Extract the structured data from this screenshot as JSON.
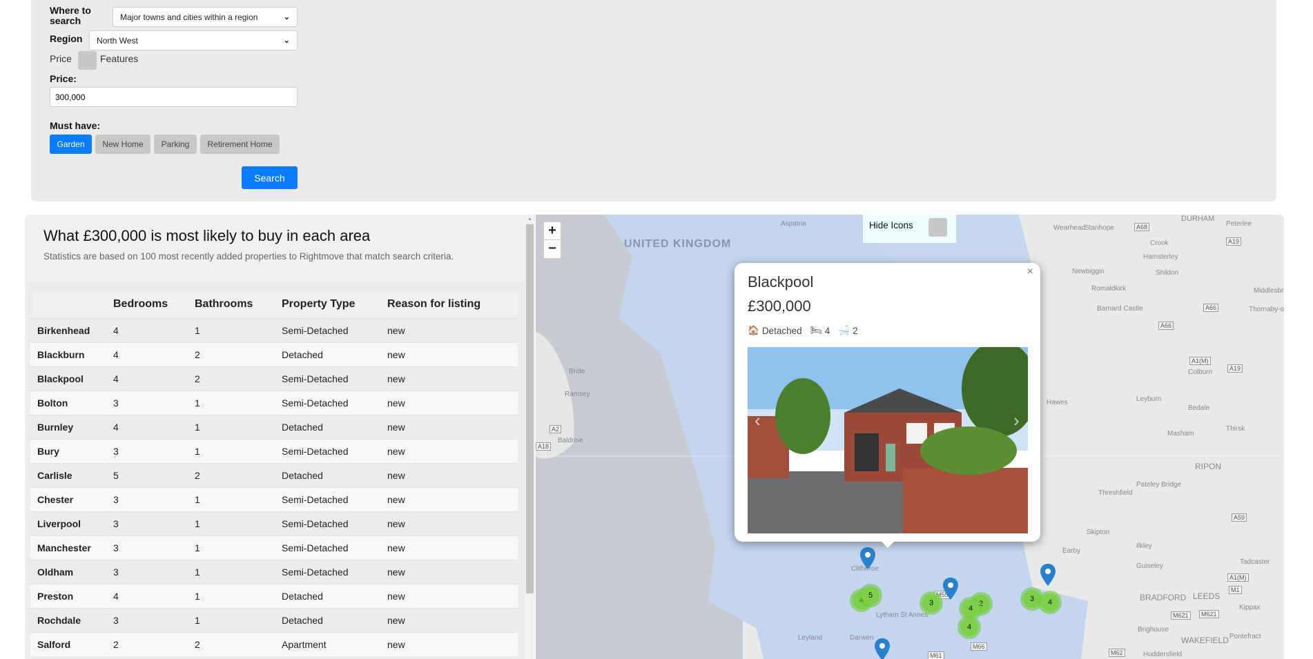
{
  "search": {
    "where_label": "Where to search",
    "where_value": "Major towns and cities within a region",
    "region_label": "Region",
    "region_value": "North West",
    "toggle_left": "Price",
    "toggle_right": "Features",
    "price_label": "Price:",
    "price_value": "300,000",
    "must_have_label": "Must have:",
    "features": [
      {
        "label": "Garden",
        "active": true
      },
      {
        "label": "New Home",
        "active": false
      },
      {
        "label": "Parking",
        "active": false
      },
      {
        "label": "Retirement Home",
        "active": false
      }
    ],
    "search_button": "Search"
  },
  "results": {
    "title": "What £300,000 is most likely to buy in each area",
    "subtitle": "Statistics are based on 100 most recently added properties to Rightmove that match search criteria.",
    "columns": [
      "",
      "Bedrooms",
      "Bathrooms",
      "Property Type",
      "Reason for listing"
    ],
    "rows": [
      [
        "Birkenhead",
        "4",
        "1",
        "Semi-Detached",
        "new"
      ],
      [
        "Blackburn",
        "4",
        "2",
        "Detached",
        "new"
      ],
      [
        "Blackpool",
        "4",
        "2",
        "Semi-Detached",
        "new"
      ],
      [
        "Bolton",
        "3",
        "1",
        "Semi-Detached",
        "new"
      ],
      [
        "Burnley",
        "4",
        "1",
        "Detached",
        "new"
      ],
      [
        "Bury",
        "3",
        "1",
        "Semi-Detached",
        "new"
      ],
      [
        "Carlisle",
        "5",
        "2",
        "Detached",
        "new"
      ],
      [
        "Chester",
        "3",
        "1",
        "Semi-Detached",
        "new"
      ],
      [
        "Liverpool",
        "3",
        "1",
        "Semi-Detached",
        "new"
      ],
      [
        "Manchester",
        "3",
        "1",
        "Semi-Detached",
        "new"
      ],
      [
        "Oldham",
        "3",
        "1",
        "Semi-Detached",
        "new"
      ],
      [
        "Preston",
        "4",
        "1",
        "Detached",
        "new"
      ],
      [
        "Rochdale",
        "3",
        "1",
        "Detached",
        "new"
      ],
      [
        "Salford",
        "2",
        "2",
        "Apartment",
        "new"
      ]
    ]
  },
  "map": {
    "zoom_in": "+",
    "zoom_out": "−",
    "hide_icons_label": "Hide Icons",
    "popup": {
      "title": "Blackpool",
      "price": "£300,000",
      "type": "Detached",
      "beds": "4",
      "baths": "2",
      "close": "×"
    },
    "labels": [
      "Aspatria",
      "UNITED KINGDOM",
      "DURHAM",
      "Wearhead",
      "Stanhope",
      "Peterlee",
      "Crook",
      "Hamsterley",
      "Shildon",
      "Newbiggin",
      "Romaldkirk",
      "Barnard Castle",
      "Hawes",
      "Leyburn",
      "Bedale",
      "Masham",
      "Thirsk",
      "RIPON",
      "Pateley Bridge",
      "Threshfield",
      "Skipton",
      "Earby",
      "Ilkley",
      "Guiseley",
      "Tadcaster",
      "BRADFORD",
      "LEEDS",
      "Kippax",
      "Brighouse",
      "WAKEFIELD",
      "Pontefract",
      "Huddersfield",
      "Clitheroe",
      "Leyland",
      "Darwen",
      "Lytham St Annes",
      "Ramsey",
      "Bride",
      "Baldrine",
      "Colburn",
      "Middlesbro",
      "Thornaby-on-Tees"
    ],
    "roads": [
      "A68",
      "A19",
      "A66",
      "A66",
      "A1(M)",
      "A19",
      "A59",
      "A1(M)",
      "M1",
      "M621",
      "M621",
      "M62",
      "M61",
      "M66",
      "M55",
      "A2",
      "A18"
    ],
    "clusters": [
      "4",
      "5",
      "3",
      "2",
      "4",
      "4",
      "3",
      "4"
    ]
  }
}
